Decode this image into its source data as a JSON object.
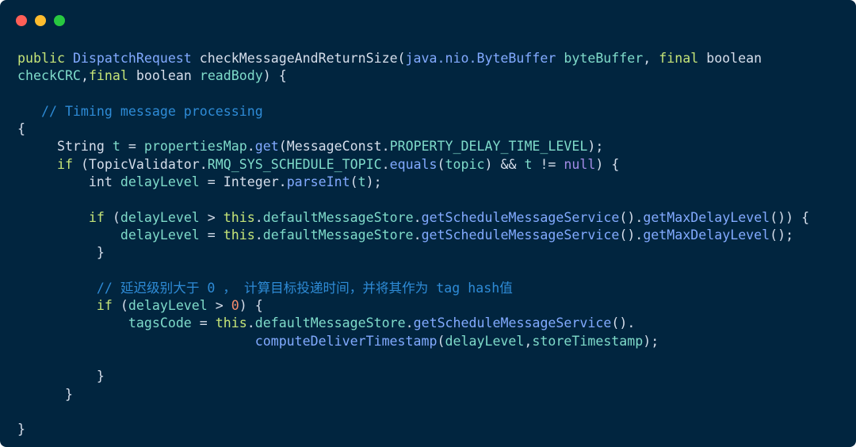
{
  "window": {
    "background": "#01253f",
    "buttons": [
      {
        "name": "close",
        "color": "#ff5f57"
      },
      {
        "name": "minimize",
        "color": "#febc2e"
      },
      {
        "name": "zoom",
        "color": "#28c840"
      }
    ]
  },
  "palette": {
    "kw": "#c5e478",
    "plain": "#d6deeb",
    "type": "#82aaff",
    "ident": "#7fdbca",
    "method": "#82aaff",
    "comment": "#2e8bd6",
    "null": "#a28be6",
    "number": "#f78c6c",
    "punc": "#d6deeb"
  },
  "code_lines": [
    [
      [
        "kw",
        "public "
      ],
      [
        "type",
        "DispatchRequest "
      ],
      [
        "plain",
        "checkMessageAndReturnSize("
      ],
      [
        "type",
        "java.nio.ByteBuffer "
      ],
      [
        "ident",
        "byteBuffer"
      ],
      [
        "plain",
        ", "
      ],
      [
        "kw",
        "final "
      ],
      [
        "plain",
        "boolean"
      ]
    ],
    [
      [
        "ident",
        "checkCRC"
      ],
      [
        "plain",
        ","
      ],
      [
        "kw",
        "final "
      ],
      [
        "plain",
        "boolean "
      ],
      [
        "ident",
        "readBody"
      ],
      [
        "plain",
        ") {"
      ]
    ],
    [],
    [
      [
        "comment",
        "   // Timing message processing"
      ]
    ],
    [
      [
        "plain",
        "{"
      ]
    ],
    [
      [
        "plain",
        "     String "
      ],
      [
        "ident",
        "t"
      ],
      [
        "plain",
        " = "
      ],
      [
        "ident",
        "propertiesMap"
      ],
      [
        "plain",
        "."
      ],
      [
        "method",
        "get"
      ],
      [
        "plain",
        "(MessageConst."
      ],
      [
        "ident",
        "PROPERTY_DELAY_TIME_LEVEL"
      ],
      [
        "plain",
        ");"
      ]
    ],
    [
      [
        "kw",
        "     if "
      ],
      [
        "plain",
        "(TopicValidator."
      ],
      [
        "ident",
        "RMQ_SYS_SCHEDULE_TOPIC"
      ],
      [
        "plain",
        "."
      ],
      [
        "method",
        "equals"
      ],
      [
        "plain",
        "("
      ],
      [
        "ident",
        "topic"
      ],
      [
        "plain",
        ") && "
      ],
      [
        "ident",
        "t"
      ],
      [
        "plain",
        " != "
      ],
      [
        "null",
        "null"
      ],
      [
        "plain",
        ") {"
      ]
    ],
    [
      [
        "plain",
        "         int "
      ],
      [
        "ident",
        "delayLevel"
      ],
      [
        "plain",
        " = Integer."
      ],
      [
        "method",
        "parseInt"
      ],
      [
        "plain",
        "("
      ],
      [
        "ident",
        "t"
      ],
      [
        "plain",
        ");"
      ]
    ],
    [],
    [
      [
        "kw",
        "         if "
      ],
      [
        "plain",
        "("
      ],
      [
        "ident",
        "delayLevel"
      ],
      [
        "plain",
        " > "
      ],
      [
        "kw",
        "this"
      ],
      [
        "plain",
        "."
      ],
      [
        "ident",
        "defaultMessageStore"
      ],
      [
        "plain",
        "."
      ],
      [
        "method",
        "getScheduleMessageService"
      ],
      [
        "plain",
        "()."
      ],
      [
        "method",
        "getMaxDelayLevel"
      ],
      [
        "plain",
        "()) {"
      ]
    ],
    [
      [
        "plain",
        "             "
      ],
      [
        "ident",
        "delayLevel"
      ],
      [
        "plain",
        " = "
      ],
      [
        "kw",
        "this"
      ],
      [
        "plain",
        "."
      ],
      [
        "ident",
        "defaultMessageStore"
      ],
      [
        "plain",
        "."
      ],
      [
        "method",
        "getScheduleMessageService"
      ],
      [
        "plain",
        "()."
      ],
      [
        "method",
        "getMaxDelayLevel"
      ],
      [
        "plain",
        "();"
      ]
    ],
    [
      [
        "plain",
        "          }"
      ]
    ],
    [],
    [
      [
        "comment",
        "          // 延迟级别大于 0 ， 计算目标投递时间，并将其作为 tag hash值"
      ]
    ],
    [
      [
        "kw",
        "          if "
      ],
      [
        "plain",
        "("
      ],
      [
        "ident",
        "delayLevel"
      ],
      [
        "plain",
        " > "
      ],
      [
        "number",
        "0"
      ],
      [
        "plain",
        ") {"
      ]
    ],
    [
      [
        "plain",
        "              "
      ],
      [
        "ident",
        "tagsCode"
      ],
      [
        "plain",
        " = "
      ],
      [
        "kw",
        "this"
      ],
      [
        "plain",
        "."
      ],
      [
        "ident",
        "defaultMessageStore"
      ],
      [
        "plain",
        "."
      ],
      [
        "method",
        "getScheduleMessageService"
      ],
      [
        "plain",
        "()."
      ]
    ],
    [
      [
        "plain",
        "                              "
      ],
      [
        "method",
        "computeDeliverTimestamp"
      ],
      [
        "plain",
        "("
      ],
      [
        "ident",
        "delayLevel"
      ],
      [
        "plain",
        ","
      ],
      [
        "ident",
        "storeTimestamp"
      ],
      [
        "plain",
        ");"
      ]
    ],
    [],
    [
      [
        "plain",
        "          }"
      ]
    ],
    [
      [
        "plain",
        "      }"
      ]
    ],
    [],
    [
      [
        "plain",
        "}"
      ]
    ]
  ]
}
